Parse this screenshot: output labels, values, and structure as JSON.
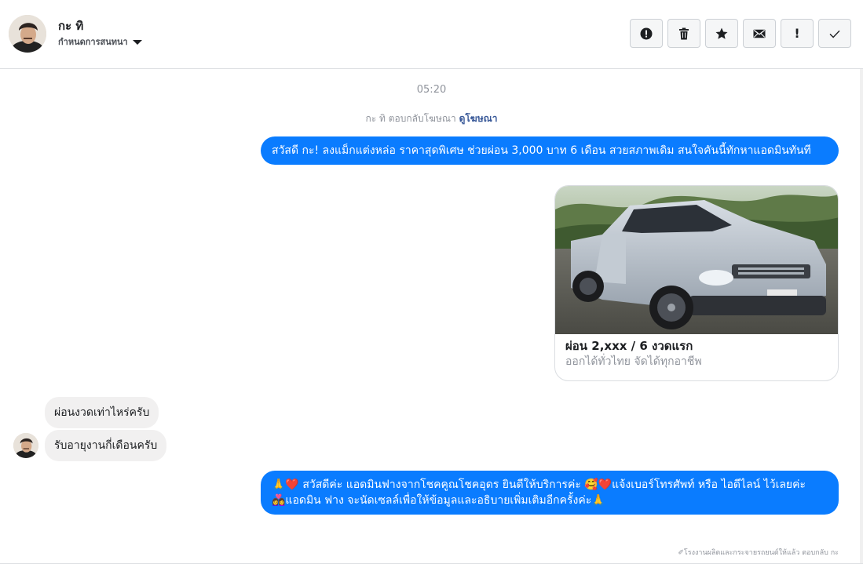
{
  "header": {
    "contact_name": "กะ ทิ",
    "subtitle": "กำหนดการสนทนา",
    "actions": [
      {
        "name": "report-spam-button",
        "icon": "alert-circle-icon"
      },
      {
        "name": "delete-button",
        "icon": "trash-icon"
      },
      {
        "name": "star-button",
        "icon": "star-icon"
      },
      {
        "name": "mark-unread-button",
        "icon": "envelope-icon"
      },
      {
        "name": "priority-button",
        "icon": "exclamation-icon",
        "label": "!"
      },
      {
        "name": "mark-done-button",
        "icon": "checkmark-icon"
      }
    ]
  },
  "conversation": {
    "timestamp": "05:20",
    "ad_reply_prefix": "กะ ทิ ตอบกลับโฆษณา",
    "ad_reply_link": "ดูโฆษณา",
    "messages": {
      "m1": "สวัสดี กะ! ลงแม็กแต่งหล่อ ราคาสุดพิเศษ ช่วยผ่อน 3,000 บาท 6 เดือน สวยสภาพเดิม สนใจคันนี้ทักหาแอดมินทันที",
      "card_title": "ผ่อน 2,xxx / 6 งวดแรก",
      "card_subtitle": "ออกได้ทั่วไทย จัดได้ทุกอาชีพ",
      "in1": "ผ่อนงวดเท่าไหร่ครับ",
      "in2": "รับอายุงานกี่เดือนครับ",
      "m2_line1": "🙏❤️ สวัสดีค่ะ แอดมินฟางจากโชคคูณโชคอุดร ยินดีให้บริการค่ะ 🥰❤️แจ้งเบอร์โทรศัพท์ หรือ ไอดีไลน์ ไว้เลยค่ะ",
      "m2_line2": "👩‍❤️‍👩แอดมิน ฟาง จะนัดเซลล์เพื่อให้ข้อมูลและอธิบายเพิ่มเติมอีกครั้งค่ะ🙏"
    },
    "footer_note": "✐โรงงานผลิตและกระจายรถยนต์ให้แล้ว ตอบกลับ กะ"
  },
  "colors": {
    "outgoing_bubble": "#0a7cff",
    "incoming_bubble": "#f1f0f0",
    "link": "#385898"
  }
}
